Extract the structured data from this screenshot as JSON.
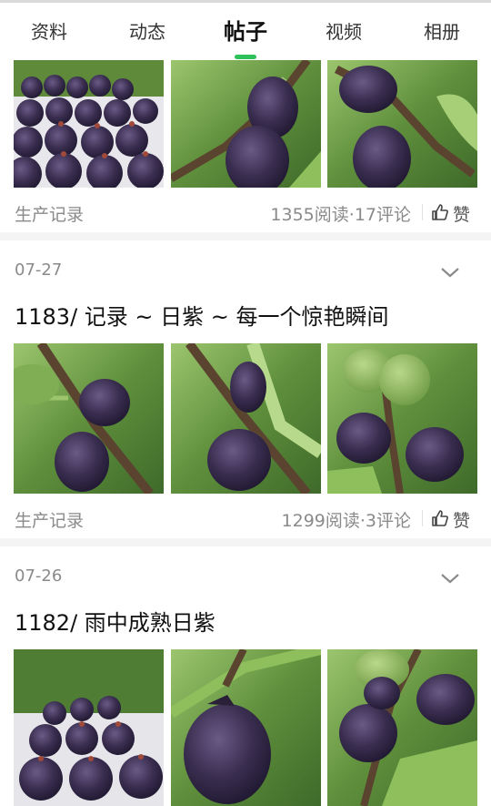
{
  "tabs": [
    {
      "label": "资料",
      "active": false
    },
    {
      "label": "动态",
      "active": false
    },
    {
      "label": "帖子",
      "active": true
    },
    {
      "label": "视频",
      "active": false
    },
    {
      "label": "相册",
      "active": false
    }
  ],
  "colors": {
    "accent": "#2fc25b",
    "fig_purple": "#3b2f52",
    "leaf_green": "#6fa54a"
  },
  "posts": [
    {
      "category": "生产记录",
      "stats": "1355阅读·17评论",
      "like_label": "赞",
      "photos": [
        "fig-tray-photo",
        "fig-on-branch-photo",
        "fig-on-branch-photo"
      ]
    },
    {
      "date": "07-27",
      "title": "1183/  记录 ~ 日紫 ~ 每一个惊艳瞬间",
      "category": "生产记录",
      "stats": "1299阅读·3评论",
      "like_label": "赞",
      "photos": [
        "fig-on-branch-photo",
        "fig-on-branch-photo",
        "fig-cluster-photo"
      ]
    },
    {
      "date": "07-26",
      "title": "1182/ 雨中成熟日紫",
      "photos": [
        "fig-tray-photo",
        "single-fig-photo",
        "fig-cluster-photo"
      ]
    }
  ]
}
